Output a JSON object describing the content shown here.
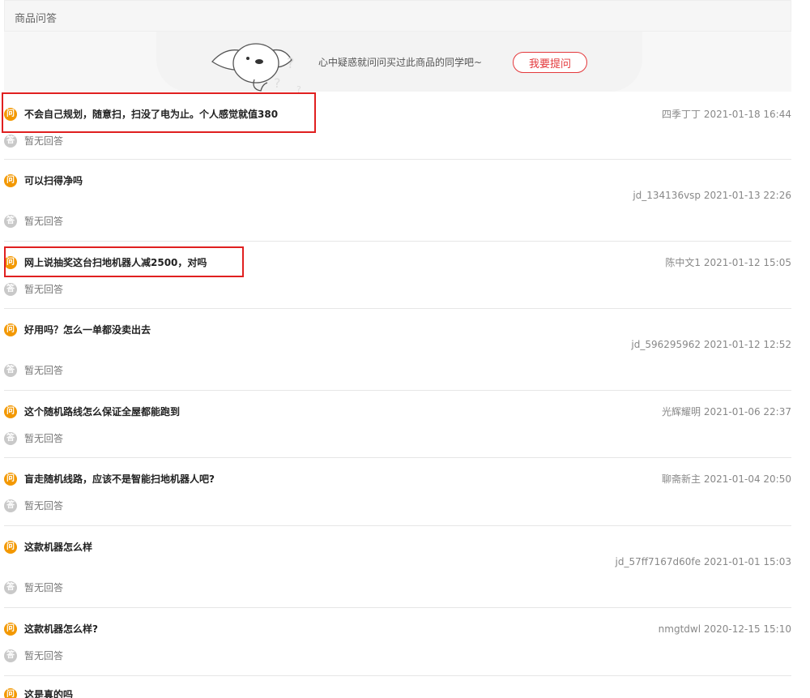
{
  "section": {
    "title": "商品问答"
  },
  "banner": {
    "text": "心中疑惑就问问买过此商品的同学吧~",
    "ask_label": "我要提问"
  },
  "badges": {
    "question": "问",
    "answer": "答"
  },
  "items": [
    {
      "question": "不会自己规划，随意扫，扫没了电为止。个人感觉就值380",
      "meta": "四季丁丁 2021-01-18 16:44",
      "answer": "暂无回答"
    },
    {
      "question": "可以扫得净吗",
      "meta": "jd_134136vsp 2021-01-13 22:26",
      "answer": "暂无回答"
    },
    {
      "question": "网上说抽奖这台扫地机器人减2500，对吗",
      "meta": "陈中文1 2021-01-12 15:05",
      "answer": "暂无回答"
    },
    {
      "question": "好用吗？怎么一单都没卖出去",
      "meta": "jd_596295962 2021-01-12 12:52",
      "answer": "暂无回答"
    },
    {
      "question": "这个随机路线怎么保证全屋都能跑到",
      "meta": "光辉耀明 2021-01-06 22:37",
      "answer": "暂无回答"
    },
    {
      "question": "盲走随机线路，应该不是智能扫地机器人吧?",
      "meta": "聊斋新主 2021-01-04 20:50",
      "answer": "暂无回答"
    },
    {
      "question": "这款机器怎么样",
      "meta": "jd_57ff7167d60fe 2021-01-01 15:03",
      "answer": "暂无回答"
    },
    {
      "question": "这款机器怎么样?",
      "meta": "nmgtdwl 2020-12-15 15:10",
      "answer": "暂无回答"
    },
    {
      "question": "这是真的吗",
      "meta": "",
      "answer": ""
    }
  ]
}
